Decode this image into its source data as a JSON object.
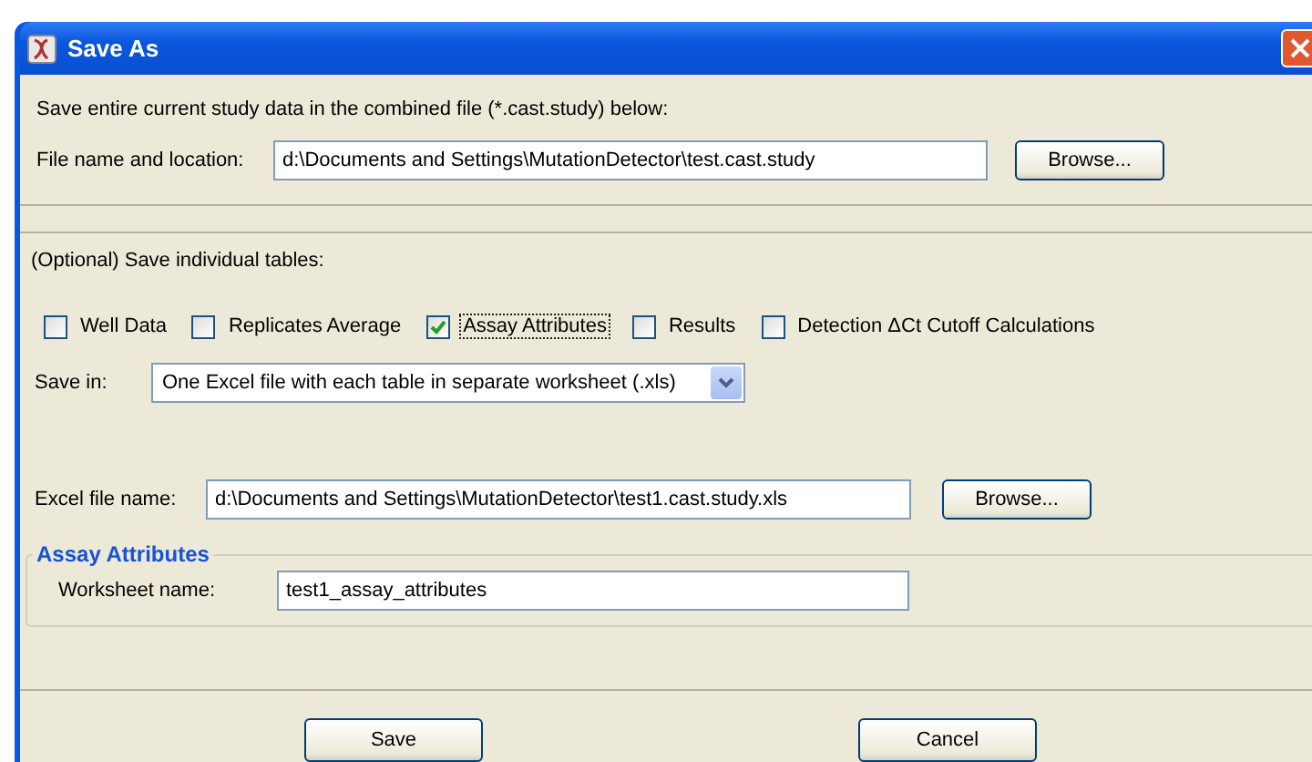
{
  "window": {
    "title": "Save As"
  },
  "combined": {
    "description": "Save entire current study data in the combined file (*.cast.study) below:",
    "label": "File name and location:",
    "value": "d:\\Documents and Settings\\MutationDetector\\test.cast.study",
    "browse": "Browse..."
  },
  "tables": {
    "heading": "(Optional) Save individual tables:",
    "options": [
      {
        "label": "Well Data",
        "checked": false,
        "focused": false
      },
      {
        "label": "Replicates Average",
        "checked": false,
        "focused": false
      },
      {
        "label": "Assay Attributes",
        "checked": true,
        "focused": true
      },
      {
        "label": "Results",
        "checked": false,
        "focused": false
      },
      {
        "label": "Detection ΔCt Cutoff Calculations",
        "checked": false,
        "focused": false
      }
    ]
  },
  "save_in": {
    "label": "Save in:",
    "value": "One Excel file with each table in separate worksheet (.xls)"
  },
  "excel": {
    "label": "Excel file name:",
    "value": "d:\\Documents and Settings\\MutationDetector\\test1.cast.study.xls",
    "browse": "Browse..."
  },
  "group": {
    "title": "Assay Attributes",
    "label": "Worksheet name:",
    "value": "test1_assay_attributes"
  },
  "buttons": [
    "Save",
    "Cancel"
  ]
}
